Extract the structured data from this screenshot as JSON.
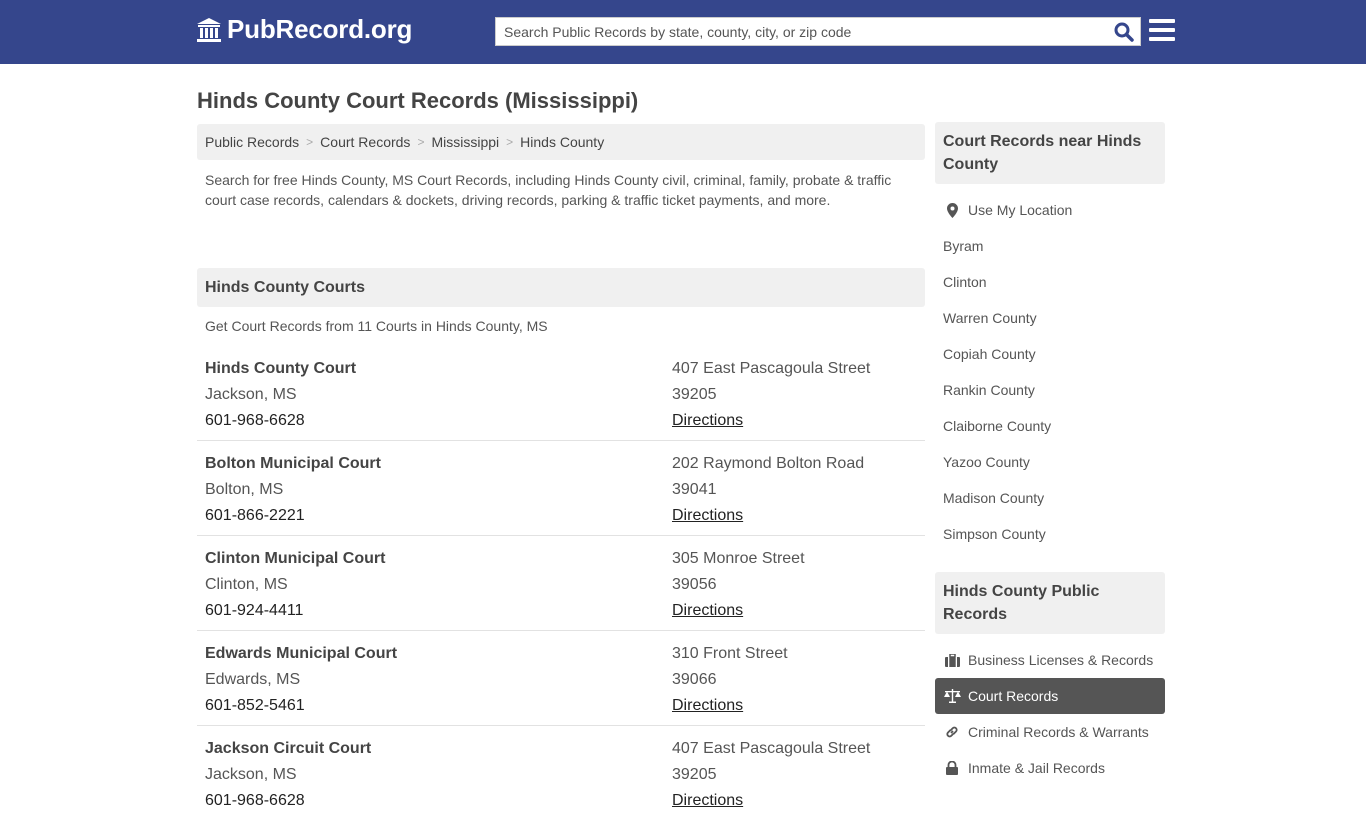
{
  "header": {
    "logo_text": "PubRecord.org",
    "search_placeholder": "Search Public Records by state, county, city, or zip code",
    "colors": {
      "bar": "#35468c",
      "search_icon": "#35468c"
    }
  },
  "page_title": "Hinds County Court Records (Mississippi)",
  "breadcrumb": [
    {
      "label": "Public Records"
    },
    {
      "label": "Court Records"
    },
    {
      "label": "Mississippi"
    },
    {
      "label": "Hinds County"
    }
  ],
  "breadcrumb_separator": ">",
  "intro": "Search for free Hinds County, MS Court Records, including Hinds County civil, criminal, family, probate & traffic court case records, calendars & dockets, driving records, parking & traffic ticket payments, and more.",
  "courts_section": {
    "title": "Hinds County Courts",
    "subtitle": "Get Court Records from 11 Courts in Hinds County, MS",
    "directions_label": "Directions",
    "courts": [
      {
        "name": "Hinds County Court",
        "city": "Jackson, MS",
        "phone": "601-968-6628",
        "street": "407 East Pascagoula Street",
        "zip": "39205"
      },
      {
        "name": "Bolton Municipal Court",
        "city": "Bolton, MS",
        "phone": "601-866-2221",
        "street": "202 Raymond Bolton Road",
        "zip": "39041"
      },
      {
        "name": "Clinton Municipal Court",
        "city": "Clinton, MS",
        "phone": "601-924-4411",
        "street": "305 Monroe Street",
        "zip": "39056"
      },
      {
        "name": "Edwards Municipal Court",
        "city": "Edwards, MS",
        "phone": "601-852-5461",
        "street": "310 Front Street",
        "zip": "39066"
      },
      {
        "name": "Jackson Circuit Court",
        "city": "Jackson, MS",
        "phone": "601-968-6628",
        "street": "407 East Pascagoula Street",
        "zip": "39205"
      }
    ]
  },
  "sidebar_nearby": {
    "title": "Court Records near Hinds County",
    "use_location": "Use My Location",
    "items": [
      "Byram",
      "Clinton",
      "Warren County",
      "Copiah County",
      "Rankin County",
      "Claiborne County",
      "Yazoo County",
      "Madison County",
      "Simpson County"
    ]
  },
  "sidebar_public": {
    "title": "Hinds County Public Records",
    "items": [
      {
        "label": "Business Licenses & Records",
        "icon": "briefcase-icon",
        "active": false
      },
      {
        "label": "Court Records",
        "icon": "scale-icon",
        "active": true
      },
      {
        "label": "Criminal Records & Warrants",
        "icon": "link-icon",
        "active": false
      },
      {
        "label": "Inmate & Jail Records",
        "icon": "lock-icon",
        "active": false
      }
    ]
  }
}
